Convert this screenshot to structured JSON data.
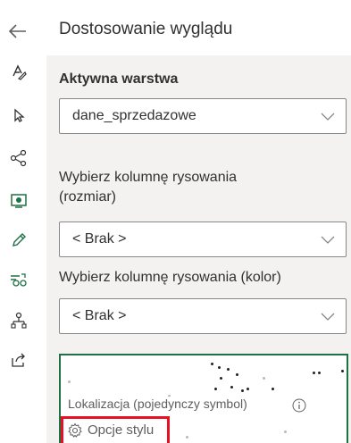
{
  "header": {
    "title": "Dostosowanie wyglądu"
  },
  "active_layer": {
    "label": "Aktywna warstwa",
    "value": "dane_sprzedazowe"
  },
  "size_column": {
    "label_line1": "Wybierz kolumnę rysowania",
    "label_line2": "(rozmiar)",
    "value": "< Brak >"
  },
  "color_column": {
    "label": "Wybierz kolumnę rysowania (kolor)",
    "value": "< Brak >"
  },
  "preview": {
    "location_label": "Lokalizacja (pojedynczy symbol)",
    "style_options": "Opcje stylu"
  },
  "rail_icons": [
    "format-icon",
    "select-icon",
    "connect-icon",
    "shield-icon",
    "pencil-icon",
    "group-icon",
    "hierarchy-icon",
    "share-icon"
  ],
  "colors": {
    "accent_green": "#1e7145",
    "highlight_red": "#e81123",
    "panel_bg": "#f3f2f1"
  }
}
